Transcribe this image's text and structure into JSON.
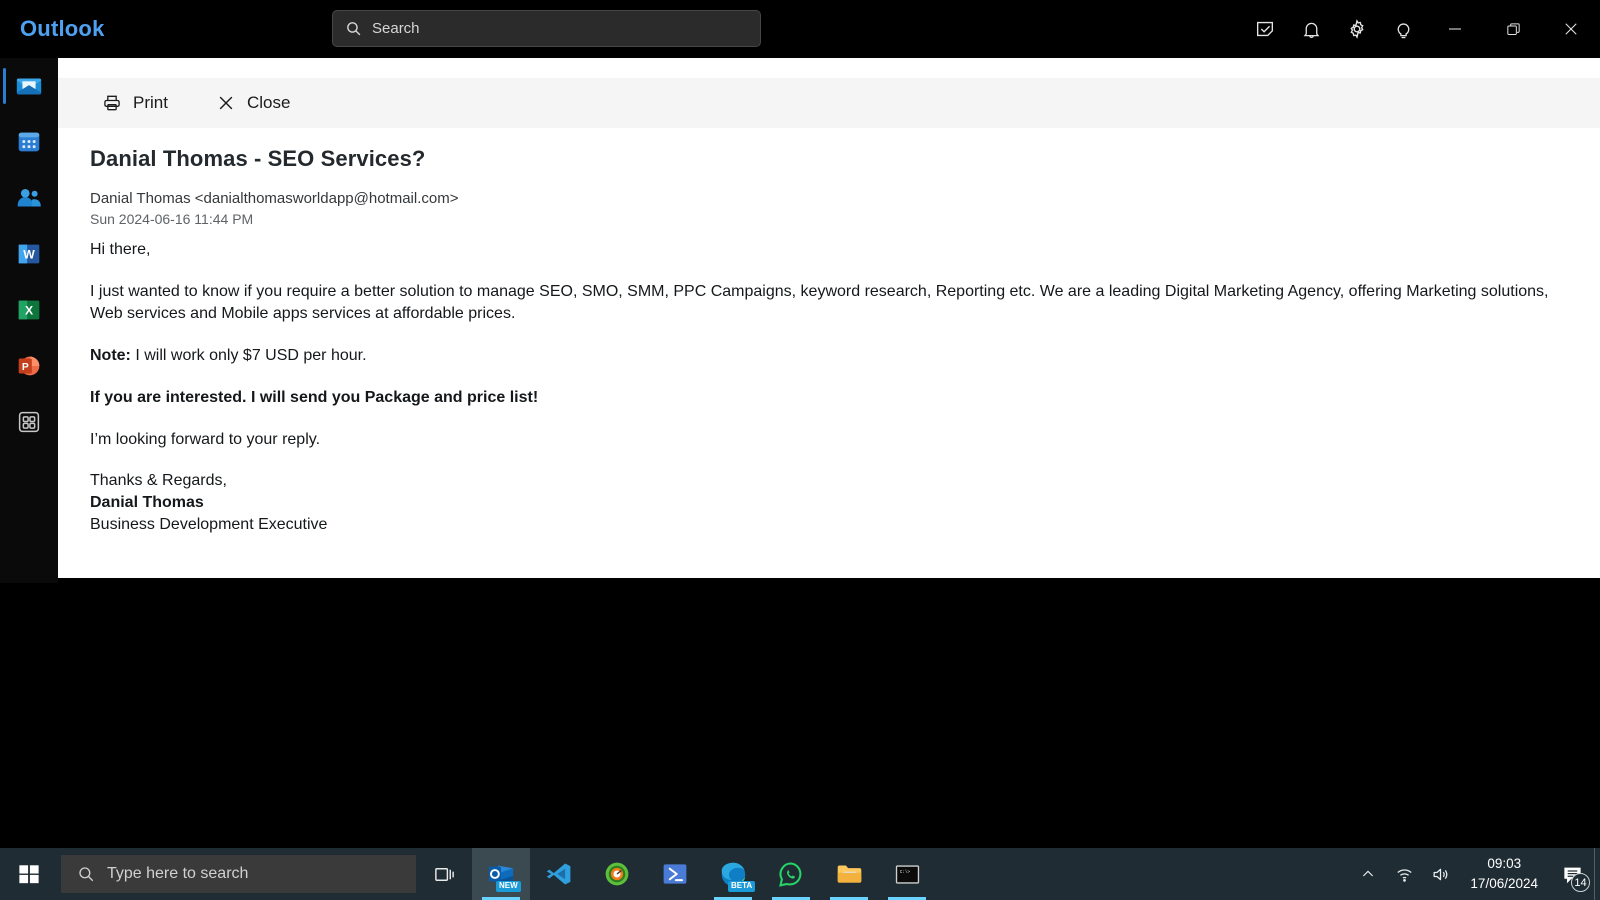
{
  "window": {
    "brand": "Outlook",
    "brand_color": "#4ea1f0",
    "search": {
      "placeholder": "Search",
      "icon": "search-icon",
      "value": ""
    },
    "controls": [
      {
        "name": "note-check-icon",
        "label": ""
      },
      {
        "name": "bell-icon",
        "label": ""
      },
      {
        "name": "gear-icon",
        "label": ""
      },
      {
        "name": "lightbulb-icon",
        "label": ""
      },
      {
        "name": "minimize-icon",
        "label": ""
      },
      {
        "name": "restore-icon",
        "label": ""
      },
      {
        "name": "close-icon",
        "label": ""
      }
    ]
  },
  "rail": {
    "items": [
      {
        "name": "mail",
        "label": "Mail",
        "selected": true
      },
      {
        "name": "calendar",
        "label": "Calendar",
        "selected": false
      },
      {
        "name": "people",
        "label": "People",
        "selected": false
      },
      {
        "name": "word",
        "label": "Word",
        "selected": false
      },
      {
        "name": "excel",
        "label": "Excel",
        "selected": false
      },
      {
        "name": "powerpoint",
        "label": "PowerPoint",
        "selected": false
      },
      {
        "name": "apps",
        "label": "Apps",
        "selected": false
      }
    ]
  },
  "toolbar": {
    "print_label": "Print",
    "print_icon": "printer-icon",
    "close_label": "Close",
    "close_icon": "close-x-icon"
  },
  "email": {
    "subject": "Danial Thomas - SEO Services?",
    "sender": "Danial Thomas <danialthomasworldapp@hotmail.com>",
    "timestamp": "Sun 2024-06-16 11:44 PM",
    "greeting": "Hi there,",
    "paragraph1": "I just wanted to know if you require a better solution to manage SEO, SMO, SMM, PPC Campaigns, keyword research, Reporting etc. We are a leading Digital Marketing Agency, offering Marketing solutions, Web services and Mobile apps services at affordable prices.",
    "note_label": "Note:",
    "note_text": " I will work only $7 USD per hour.",
    "call_to_action": "If you are interested. I will send you Package and price list!",
    "closing": "I’m looking forward to your reply.",
    "sign_off": "Thanks & Regards,",
    "sign_name": "Danial Thomas",
    "sign_title": "Business Development Executive"
  },
  "taskbar": {
    "start_icon": "windows-start-icon",
    "search": {
      "placeholder": "Type here to search",
      "icon": "search-icon",
      "value": ""
    },
    "taskview_icon": "task-view-icon",
    "apps": [
      {
        "name": "outlook",
        "label": "Outlook",
        "badge": "NEW",
        "active": true,
        "running": true
      },
      {
        "name": "vscode",
        "label": "Visual Studio Code",
        "badge": "",
        "active": false,
        "running": false
      },
      {
        "name": "optimizer",
        "label": "System Optimizer",
        "badge": "",
        "active": false,
        "running": false
      },
      {
        "name": "powershell",
        "label": "Windows PowerShell",
        "badge": "",
        "active": false,
        "running": false
      },
      {
        "name": "edge",
        "label": "Microsoft Edge",
        "badge": "BETA",
        "active": false,
        "running": true
      },
      {
        "name": "whatsapp",
        "label": "WhatsApp",
        "badge": "",
        "active": false,
        "running": true
      },
      {
        "name": "file-explorer",
        "label": "File Explorer",
        "badge": "",
        "active": false,
        "running": true
      },
      {
        "name": "command-prompt",
        "label": "Command Prompt",
        "badge": "",
        "active": false,
        "running": true
      }
    ],
    "tray": {
      "chevron_icon": "chevron-up-icon",
      "wifi_icon": "wifi-icon",
      "volume_icon": "volume-icon",
      "time": "09:03",
      "date": "17/06/2024",
      "notifications_icon": "notifications-icon",
      "notifications_count": "14"
    }
  }
}
